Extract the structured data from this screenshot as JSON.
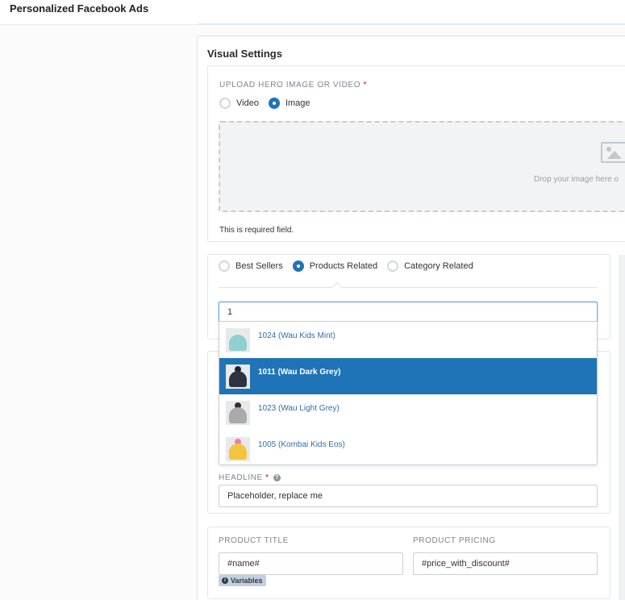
{
  "header": {
    "title": "Personalized Facebook Ads"
  },
  "visual_settings": {
    "title": "Visual Settings",
    "upload": {
      "label": "UPLOAD HERO IMAGE OR VIDEO",
      "required_mark": "*",
      "options": [
        "Video",
        "Image"
      ],
      "selected": "Image",
      "drop_text": "Drop your image here o",
      "error": "This is required field."
    },
    "products": {
      "options": [
        "Best Sellers",
        "Products Related",
        "Category Related"
      ],
      "selected": "Products Related",
      "search_value": "1",
      "results": [
        {
          "label": "1024 (Wau Kids Mint)",
          "hat_color": "#8fcfcf",
          "pom_color": "#8fcfcf"
        },
        {
          "label": "1011 (Wau Dark Grey)",
          "hat_color": "#2c3442",
          "pom_color": "#1e2430"
        },
        {
          "label": "1023 (Wau Light Grey)",
          "hat_color": "#a9aaae",
          "pom_color": "#3a2a22"
        },
        {
          "label": "1005 (Kombai Kids Eos)",
          "hat_color": "#f2c53d",
          "pom_color": "#f27aa8"
        }
      ],
      "highlighted": "1011 (Wau Dark Grey)"
    },
    "headline": {
      "label": "HEADLINE",
      "required_mark": "*",
      "value": "Placeholder, replace me"
    },
    "product_title": {
      "label": "PRODUCT TITLE",
      "value": "#name#"
    },
    "product_pricing": {
      "label": "PRODUCT PRICING",
      "value": "#price_with_discount#"
    },
    "variables_badge": "Variables"
  },
  "colors": {
    "accent": "#1f74b7",
    "required": "#d0021b"
  }
}
